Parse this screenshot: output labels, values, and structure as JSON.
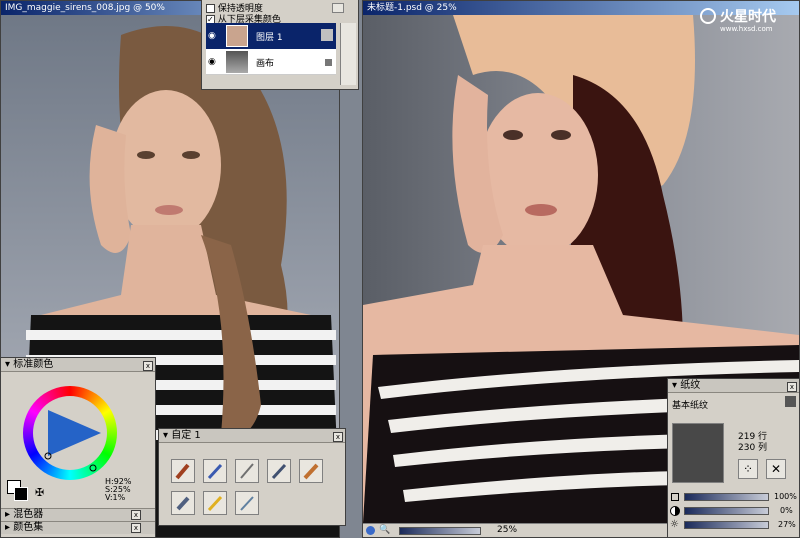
{
  "left_window": {
    "title": "IMG_maggie_sirens_008.jpg @ 50%"
  },
  "right_window": {
    "title": "未标题-1.psd @ 25%",
    "zoom": "25%"
  },
  "watermark": {
    "brand": "火星时代",
    "url": "www.hxsd.com"
  },
  "layers_panel": {
    "options": [
      {
        "label": "保持透明度",
        "checked": false
      },
      {
        "label": "从下层采集颜色",
        "checked": true
      }
    ],
    "layers": [
      {
        "name": "图层 1",
        "selected": true
      },
      {
        "name": "画布",
        "selected": false
      }
    ]
  },
  "color_panel": {
    "title": "标准颜色",
    "h": "H:92%",
    "s": "S:25%",
    "v": "V:1%",
    "collapsed": [
      "混色器",
      "颜色集"
    ]
  },
  "brush_panel": {
    "title": "自定 1",
    "tools": [
      "oil-brush-icon",
      "chalk-icon",
      "pencil-icon",
      "pen-icon",
      "marker-icon",
      "eraser-icon",
      "crayon-icon",
      "knife-icon"
    ]
  },
  "paper_panel": {
    "title": "纸纹",
    "paper_name": "基本纸纹",
    "rows": "219 行",
    "cols": "230 列",
    "sliders": [
      {
        "icon": "scale-icon",
        "value": "100%",
        "fill": 1.0
      },
      {
        "icon": "contrast-icon",
        "value": "0%",
        "fill": 0.0
      },
      {
        "icon": "brightness-icon",
        "value": "27%",
        "fill": 0.27
      }
    ]
  },
  "colors": {
    "title_bar": "#0a246a",
    "panel": "#d4d0c8",
    "selected_layer": "#0a246a"
  }
}
